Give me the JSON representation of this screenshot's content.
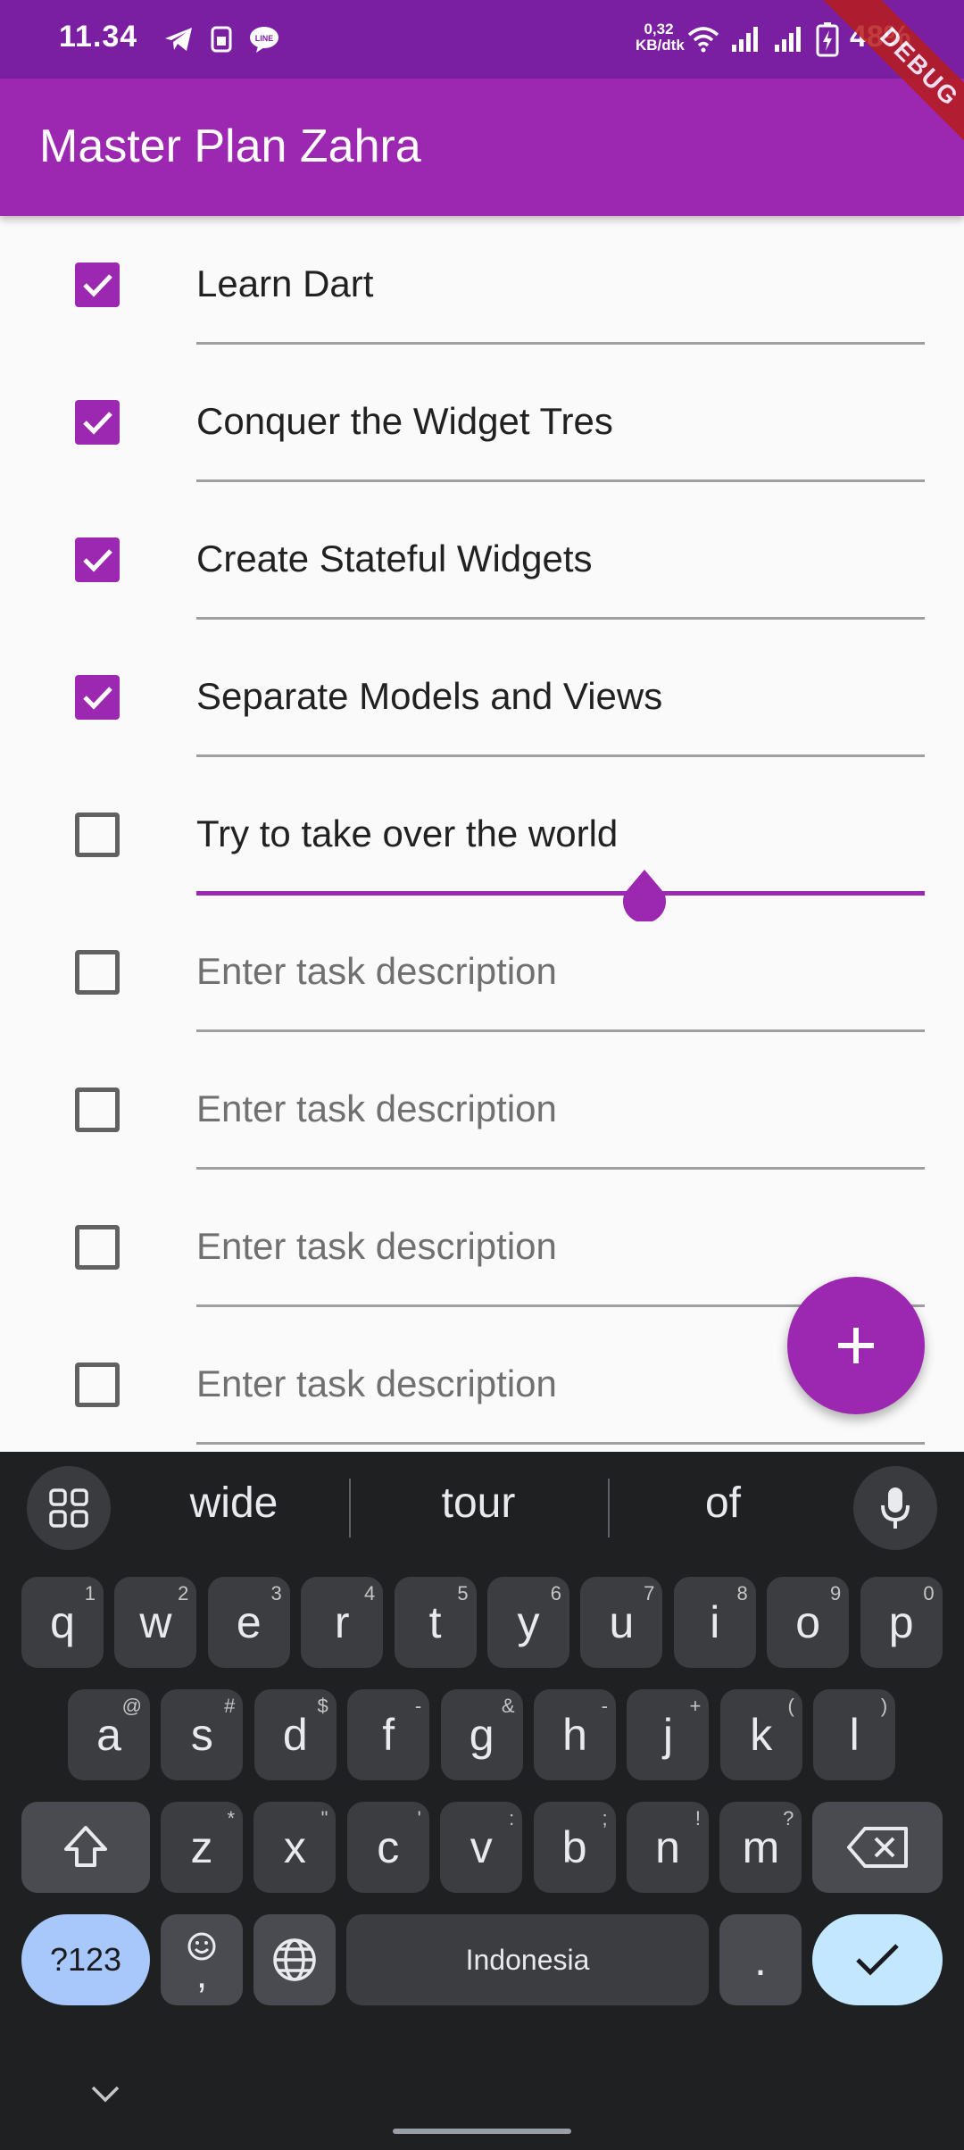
{
  "status_bar": {
    "time": "11.34",
    "net_speed_value": "0,32",
    "net_speed_unit": "KB/dtk",
    "battery": "48%",
    "icons": [
      "telegram-icon",
      "sim-icon",
      "line-icon",
      "wifi-icon",
      "signal-icon",
      "signal-icon",
      "battery-charging-icon"
    ]
  },
  "app_bar": {
    "title": "Master Plan Zahra"
  },
  "debug_banner": "DEBUG",
  "tasks": [
    {
      "text": "Learn Dart",
      "done": true
    },
    {
      "text": "Conquer the Widget Tres",
      "done": true
    },
    {
      "text": "Create Stateful Widgets",
      "done": true
    },
    {
      "text": "Separate Models and Views",
      "done": true
    },
    {
      "text": "Try to take over the world",
      "done": false,
      "focused": true
    },
    {
      "text": "",
      "done": false
    },
    {
      "text": "",
      "done": false
    },
    {
      "text": "",
      "done": false
    },
    {
      "text": "",
      "done": false
    }
  ],
  "task_placeholder": "Enter task description",
  "fab_icon": "plus-icon",
  "keyboard": {
    "suggestions": [
      "wide",
      "tour",
      "of"
    ],
    "row1": [
      [
        "q",
        "1"
      ],
      [
        "w",
        "2"
      ],
      [
        "e",
        "3"
      ],
      [
        "r",
        "4"
      ],
      [
        "t",
        "5"
      ],
      [
        "y",
        "6"
      ],
      [
        "u",
        "7"
      ],
      [
        "i",
        "8"
      ],
      [
        "o",
        "9"
      ],
      [
        "p",
        "0"
      ]
    ],
    "row2": [
      [
        "a",
        "@"
      ],
      [
        "s",
        "#"
      ],
      [
        "d",
        "$"
      ],
      [
        "f",
        "-"
      ],
      [
        "g",
        "&"
      ],
      [
        "h",
        "-"
      ],
      [
        "j",
        "+"
      ],
      [
        "k",
        "("
      ],
      [
        "l",
        ")"
      ]
    ],
    "row3": [
      [
        "z",
        "*"
      ],
      [
        "x",
        "\""
      ],
      [
        "c",
        "'"
      ],
      [
        "v",
        ":"
      ],
      [
        "b",
        ";"
      ],
      [
        "n",
        "!"
      ],
      [
        "m",
        "?"
      ]
    ],
    "symbols_label": "?123",
    "comma_label": ",",
    "space_label": "Indonesia",
    "period_label": ".",
    "colors": {
      "background": "#1f2022",
      "key": "#3c3d41",
      "symbols_key": "#a8c7fa",
      "enter_key": "#c2e7ff"
    }
  },
  "colors": {
    "primary": "#9c27b0",
    "status_bar": "#7b1fa2"
  }
}
